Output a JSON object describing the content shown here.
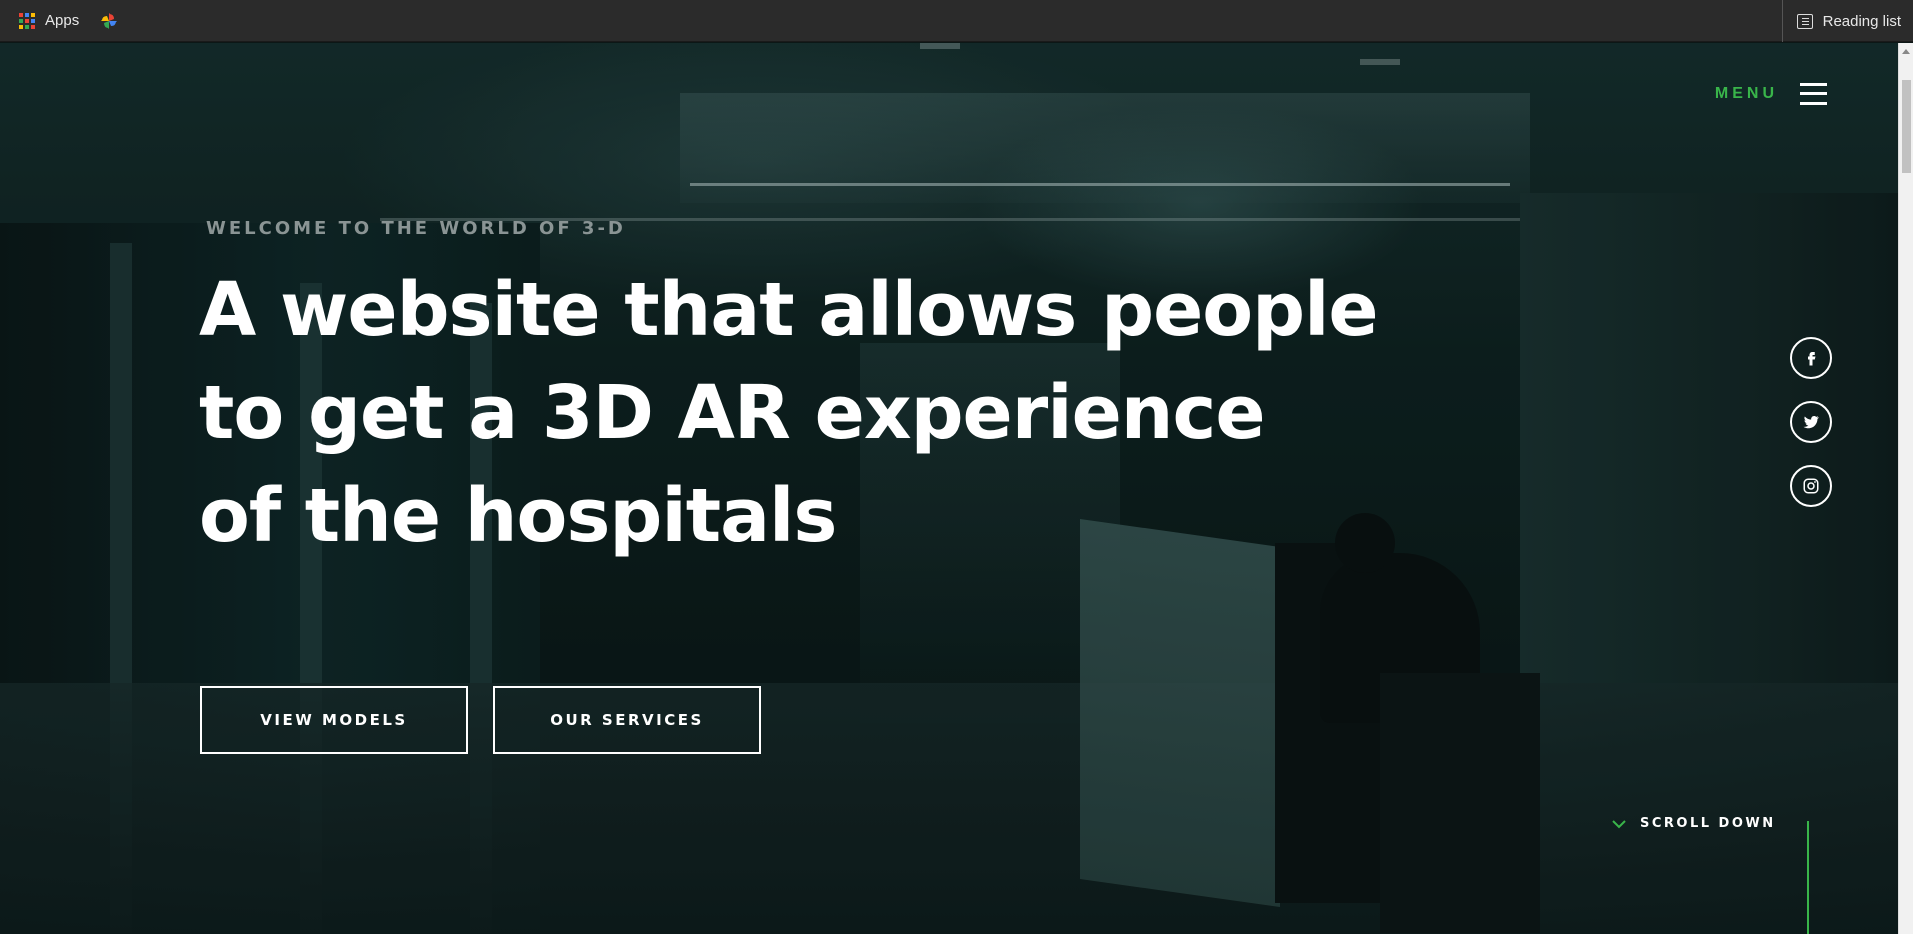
{
  "bookmarks": {
    "apps_label": "Apps",
    "apps_icon": "apps-grid-icon",
    "photos_icon": "pinwheel-icon",
    "reading_list_label": "Reading list",
    "reading_list_icon": "reading-list-icon"
  },
  "nav": {
    "menu_label": "MENU",
    "menu_icon": "hamburger-icon"
  },
  "hero": {
    "eyebrow": "WELCOME TO THE WORLD OF 3-D",
    "headline_lines": [
      "A website that allows people",
      "to get a 3D AR experience",
      "of the hospitals"
    ],
    "primary_button": "VIEW MODELS",
    "secondary_button": "OUR SERVICES"
  },
  "social": [
    {
      "icon": "facebook-icon"
    },
    {
      "icon": "twitter-icon"
    },
    {
      "icon": "instagram-icon"
    }
  ],
  "scroll": {
    "label": "SCROLL DOWN",
    "icon": "chevron-down-icon"
  },
  "colors": {
    "accent": "#39b54a",
    "text": "#ffffff",
    "eyebrow": "#8a9494",
    "bookmarks_bar": "#2b2b2b"
  }
}
